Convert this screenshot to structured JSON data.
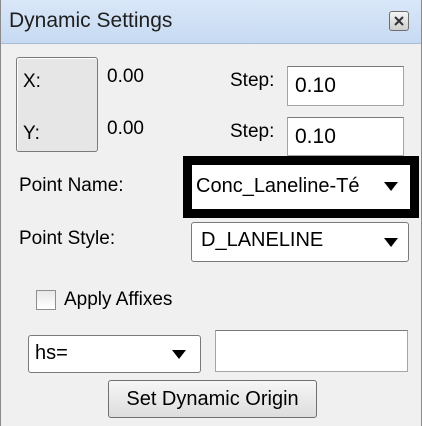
{
  "window": {
    "title": "Dynamic Settings",
    "close_icon": "close-icon"
  },
  "xy_button": {
    "x_label": "X:",
    "y_label": "Y:"
  },
  "coords": {
    "x_value": "0.00",
    "y_value": "0.00"
  },
  "step": {
    "label": "Step:",
    "x_step": "0.10",
    "y_step": "0.10"
  },
  "point_name": {
    "label": "Point Name:",
    "selected": "Conc_Laneline-Té"
  },
  "point_style": {
    "label": "Point Style:",
    "selected": "D_LANELINE"
  },
  "affixes": {
    "label": "Apply Affixes",
    "checked": false
  },
  "prefix": {
    "selected": "hs=",
    "text_value": ""
  },
  "set_origin_button": {
    "label": "Set Dynamic Origin"
  },
  "colors": {
    "titlebar": "#c7daf2",
    "highlight_frame": "#000000",
    "dialog_bg": "#f0f0f0"
  }
}
